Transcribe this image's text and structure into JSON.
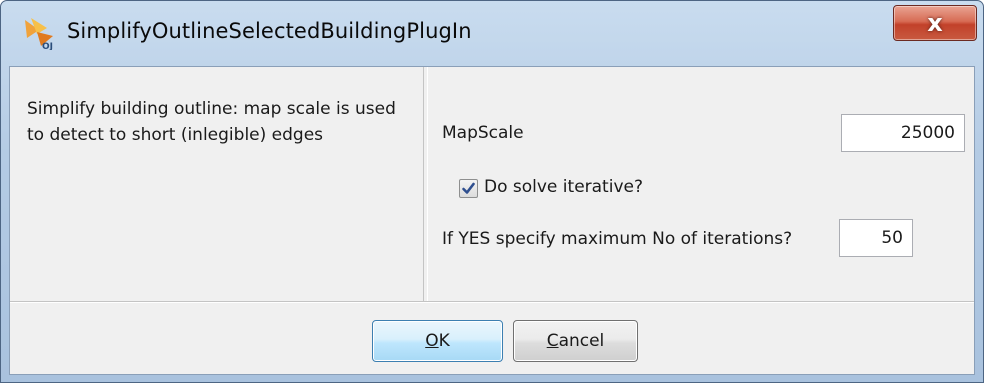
{
  "window": {
    "title": "SimplifyOutlineSelectedBuildingPlugIn",
    "close_glyph": "x"
  },
  "description": "Simplify building outline: map scale is used to detect to short (inlegible) edges",
  "form": {
    "mapscale_label": "MapScale",
    "mapscale_value": "25000",
    "iterative_label": "Do solve iterative?",
    "iterative_checked": true,
    "iterations_label": "If YES specify maximum No of iterations?",
    "iterations_value": "50"
  },
  "buttons": {
    "ok_mnemonic": "O",
    "ok_rest": "K",
    "cancel_mnemonic": "C",
    "cancel_rest": "ancel"
  },
  "icons": {
    "app": "openjump-icon",
    "close": "close-icon",
    "check": "check-icon"
  },
  "colors": {
    "title_bar": "#b4cbe4",
    "close_button": "#c2412a",
    "dialog_bg": "#f0f0f0",
    "ok_button": "#bee6fd",
    "checkbox_mark": "#2f4f8f"
  }
}
